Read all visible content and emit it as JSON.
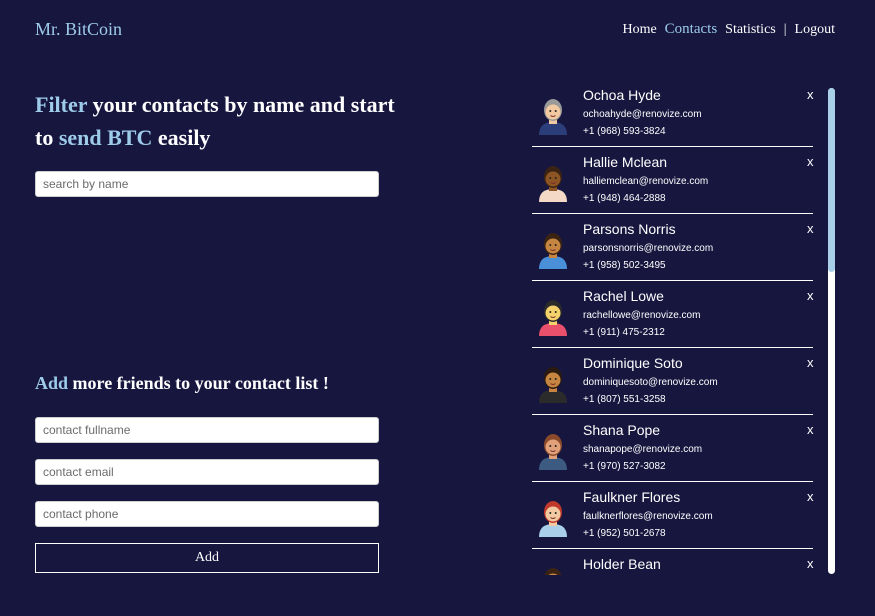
{
  "brand": "Mr. BitCoin",
  "nav": {
    "home": "Home",
    "contacts": "Contacts",
    "statistics": "Statistics",
    "separator": "|",
    "logout": "Logout"
  },
  "filter": {
    "word_filter": "Filter",
    "text_1": " your contacts by name and start to ",
    "word_send": "send BTC",
    "text_2": " easily",
    "search_placeholder": "search by name"
  },
  "add_section": {
    "word_add": "Add",
    "title_rest": " more friends to your contact list !",
    "fullname_placeholder": "contact fullname",
    "email_placeholder": "contact email",
    "phone_placeholder": "contact phone",
    "button_label": "Add"
  },
  "remove_label": "x",
  "contacts": [
    {
      "name": "Ochoa Hyde",
      "email": "ochoahyde@renovize.com",
      "phone": "+1 (968) 593-3824",
      "avatar": "avatar-gray-hair-icon",
      "skin": "#f2c9a0",
      "hair": "#9a9a9a",
      "shirt": "#2c3e7a"
    },
    {
      "name": "Hallie Mclean",
      "email": "halliemclean@renovize.com",
      "phone": "+1 (948) 464-2888",
      "avatar": "avatar-bun-hair-icon",
      "skin": "#8d5524",
      "hair": "#3b2314",
      "shirt": "#f4d9c6"
    },
    {
      "name": "Parsons Norris",
      "email": "parsonsnorris@renovize.com",
      "phone": "+1 (958) 502-3495",
      "avatar": "avatar-short-hair-icon",
      "skin": "#c68642",
      "hair": "#3b2314",
      "shirt": "#4a90d9"
    },
    {
      "name": "Rachel Lowe",
      "email": "rachellowe@renovize.com",
      "phone": "+1 (911) 475-2312",
      "avatar": "avatar-beanie-icon",
      "skin": "#f5d26b",
      "hair": "#2b2b2b",
      "shirt": "#e8506b"
    },
    {
      "name": "Dominique Soto",
      "email": "dominiquesoto@renovize.com",
      "phone": "+1 (807) 551-3258",
      "avatar": "avatar-curly-hair-icon",
      "skin": "#c68642",
      "hair": "#2b1a10",
      "shirt": "#2b2b2b"
    },
    {
      "name": "Shana Pope",
      "email": "shanapope@renovize.com",
      "phone": "+1 (970) 527-3082",
      "avatar": "avatar-long-hair-icon",
      "skin": "#e0a07a",
      "hair": "#8a4a2a",
      "shirt": "#3d5a80"
    },
    {
      "name": "Faulkner Flores",
      "email": "faulknerflores@renovize.com",
      "phone": "+1 (952) 501-2678",
      "avatar": "avatar-beard-icon",
      "skin": "#f2c9a0",
      "hair": "#c0392b",
      "shirt": "#a9cfe9"
    },
    {
      "name": "Holder Bean",
      "email": "",
      "phone": "",
      "avatar": "avatar-icon",
      "skin": "#c68642",
      "hair": "#3b2314",
      "shirt": "#4a90d9"
    }
  ],
  "colors": {
    "background": "#16163f",
    "accent": "#9ecbea",
    "scrollbar_thumb": "#a9cfe9"
  }
}
